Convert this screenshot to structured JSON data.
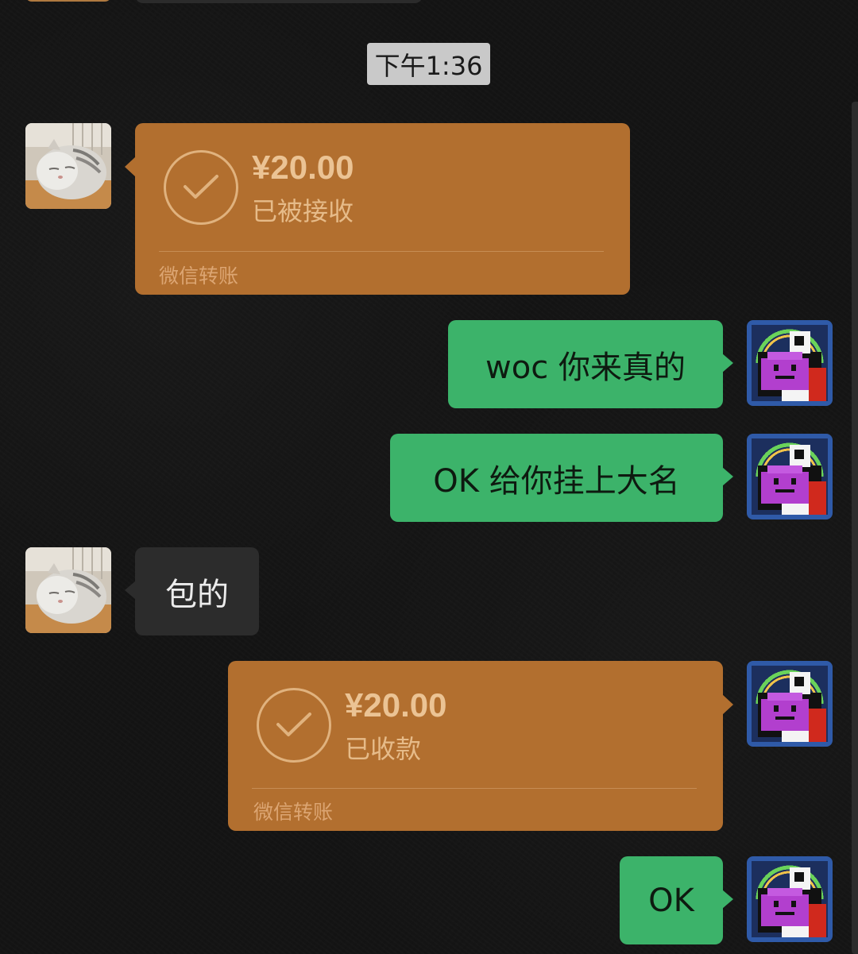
{
  "chat": {
    "timestamp": "下午1:36",
    "messages": [
      {
        "sender": "cat",
        "type": "transfer",
        "amount": "¥20.00",
        "status": "已被接收",
        "label": "微信转账"
      },
      {
        "sender": "me",
        "type": "text",
        "text": "woc 你来真的"
      },
      {
        "sender": "me",
        "type": "text",
        "text": "OK 给你挂上大名"
      },
      {
        "sender": "cat",
        "type": "text",
        "text": "包的"
      },
      {
        "sender": "me",
        "type": "transfer",
        "amount": "¥20.00",
        "status": "已收款",
        "label": "微信转账"
      },
      {
        "sender": "me",
        "type": "text",
        "text": "OK"
      }
    ]
  },
  "colors": {
    "background": "#141414",
    "transfer_card": "#b26f2f",
    "sent_bubble": "#3cb36a",
    "received_bubble": "#2c2c2c",
    "timestamp_pill": "#c9c9c9"
  },
  "icons": {
    "check": "check-circle-icon",
    "cat_avatar": "cat-avatar",
    "pixel_avatar": "pixel-monster-avatar"
  }
}
